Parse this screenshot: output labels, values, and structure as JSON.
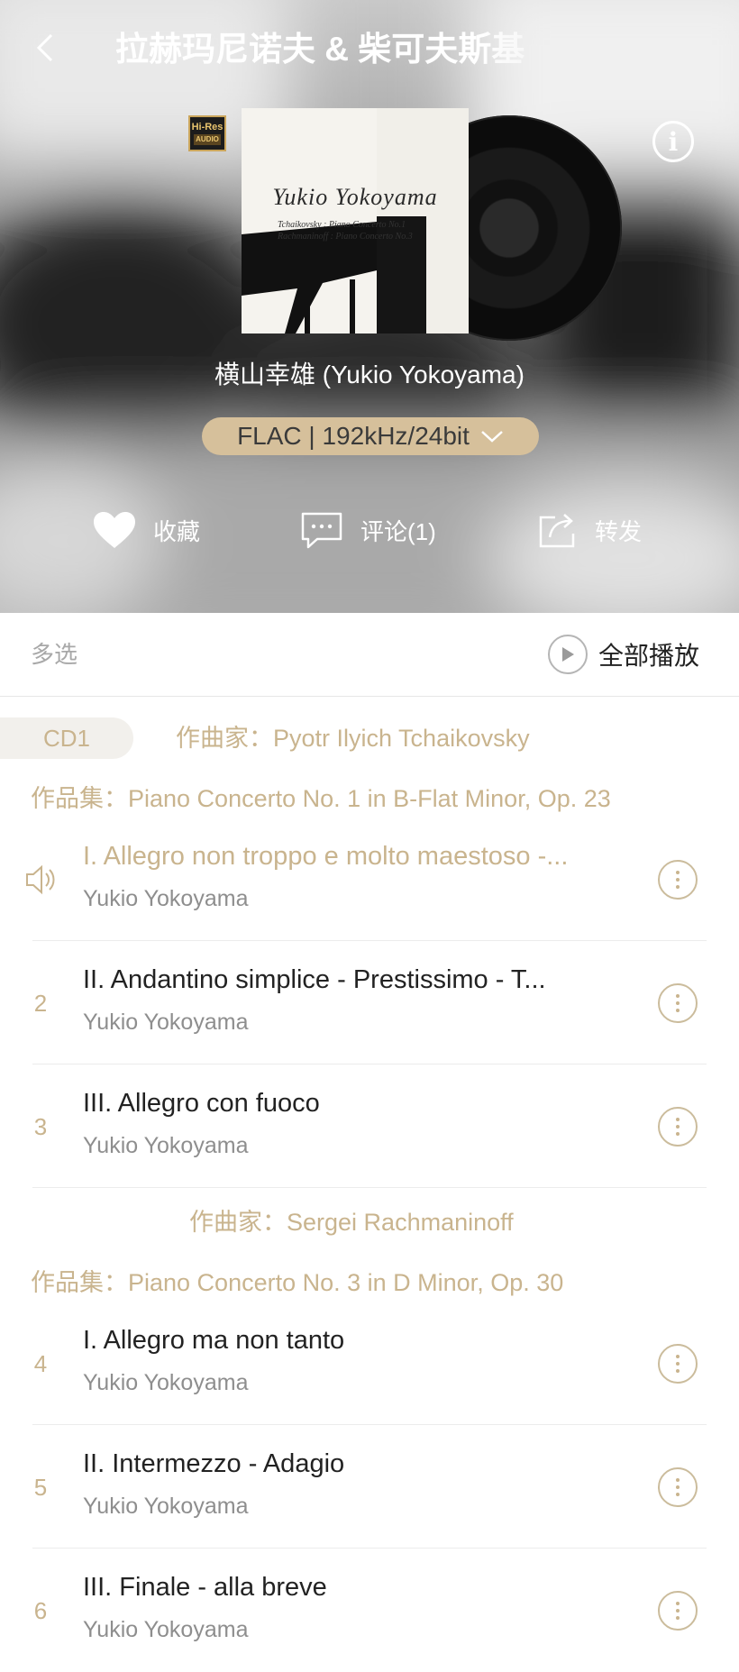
{
  "header": {
    "title": "拉赫玛尼诺夫 & 柴可夫斯基",
    "artist": "横山幸雄 (Yukio Yokoyama)",
    "format": "FLAC | 192kHz/24bit"
  },
  "cover": {
    "artist_text": "Yukio Yokoyama",
    "line1": "Tchaikovsky : Piano Concerto No.1",
    "line2": "Rachmaninoff : Piano Concerto No.3",
    "badge_top": "Hi-Res",
    "badge_bottom": "AUDIO"
  },
  "actions": {
    "favorite": "收藏",
    "comment": "评论(1)",
    "share": "转发"
  },
  "toolbar": {
    "multi_select": "多选",
    "play_all": "全部播放"
  },
  "cd_label": "CD1",
  "groups": [
    {
      "composer": "作曲家：Pyotr Ilyich Tchaikovsky",
      "work": "作品集：Piano Concerto No. 1 in B-Flat Minor, Op. 23"
    },
    {
      "composer": "作曲家：Sergei  Rachmaninoff",
      "work": "作品集：Piano Concerto No. 3 in D Minor, Op. 30"
    }
  ],
  "tracks": [
    {
      "num": "",
      "title": "I. Allegro non troppo e molto maestoso -...",
      "artist": "Yukio Yokoyama",
      "playing": true
    },
    {
      "num": "2",
      "title": "II. Andantino simplice - Prestissimo - T...",
      "artist": "Yukio Yokoyama",
      "playing": false
    },
    {
      "num": "3",
      "title": "III. Allegro con fuoco",
      "artist": "Yukio Yokoyama",
      "playing": false
    },
    {
      "num": "4",
      "title": "I. Allegro ma non tanto",
      "artist": "Yukio Yokoyama",
      "playing": false
    },
    {
      "num": "5",
      "title": "II. Intermezzo - Adagio",
      "artist": "Yukio Yokoyama",
      "playing": false
    },
    {
      "num": "6",
      "title": "III. Finale - alla breve",
      "artist": "Yukio Yokoyama",
      "playing": false
    }
  ],
  "colors": {
    "accent": "#c9b48e",
    "pill": "#d6c09b"
  }
}
